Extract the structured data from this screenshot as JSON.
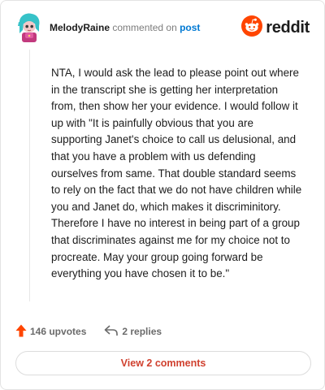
{
  "header": {
    "username": "MelodyRaine",
    "action_text": "commented on",
    "post_link": "post",
    "brand": "reddit",
    "avatar_icon": "user-avatar-illustration",
    "brand_icon": "reddit-snoo-icon"
  },
  "comment": {
    "text": "NTA, I would ask the lead to please point out where in the transcript she is getting her interpretation from, then show her your evidence. I would follow it up with \"It is painfully obvious that you are supporting Janet's choice to call us delusional, and that you have a problem with us defending ourselves from same. That double standard seems to rely on the fact that we do not have children while you and Janet do, which makes it discriminitory. Therefore I have no interest in being part of a group that discriminates against me for my choice not to procreate. May your group going forward be everything you have chosen it to be.\""
  },
  "actions": {
    "upvotes": "146 upvotes",
    "replies": "2 replies",
    "upvote_icon": "upvote-arrow-icon",
    "reply_icon": "reply-arrow-icon"
  },
  "footer": {
    "view_comments": "View 2 comments"
  },
  "colors": {
    "brand_orange": "#ff4500",
    "link_blue": "#0079d3",
    "view_button_text": "#d0412f"
  }
}
